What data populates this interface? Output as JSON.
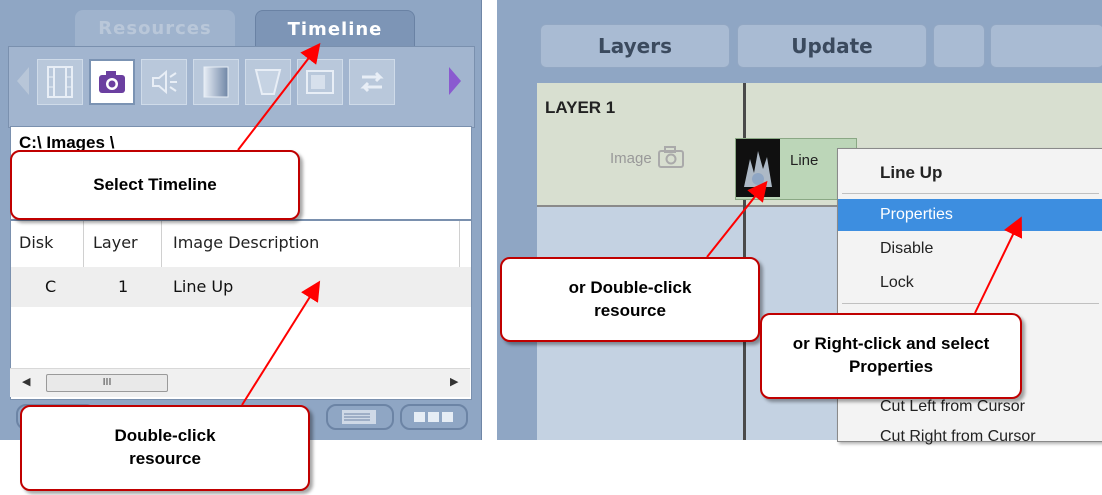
{
  "left_panel": {
    "tabs": [
      {
        "label": "Resources",
        "active": false
      },
      {
        "label": "Timeline",
        "active": true
      }
    ],
    "toolbar": {
      "icons": [
        "prev-arrow-icon",
        "film-icon",
        "camera-icon",
        "audio-icon",
        "gradient-icon",
        "shape-icon",
        "screen-icon",
        "swap-icon",
        "next-arrow-icon"
      ],
      "active_icon": "camera-icon"
    },
    "path": "C:\\ Images \\",
    "table": {
      "columns": [
        "Disk",
        "Layer",
        "Image Description"
      ],
      "rows": [
        {
          "disk": "C",
          "layer": "1",
          "description": "Line Up"
        }
      ]
    },
    "scrollbar_thumb_text": "III"
  },
  "right_panel": {
    "buttons": {
      "layers": "Layers",
      "update": "Update"
    },
    "layer_title": "LAYER 1",
    "image_label": "Image",
    "clip_label": "Line",
    "context_menu": {
      "header": "Line Up",
      "items": [
        "Properties",
        "Disable",
        "Lock",
        "Cut Left from Cursor",
        "Cut Right from Cursor"
      ],
      "selected": "Properties"
    }
  },
  "callouts": {
    "select_timeline": "Select Timeline",
    "double_click_left": "Double-click resource",
    "double_click_right": "or Double-click resource",
    "right_click": "or Right-click and select Properties"
  },
  "colors": {
    "panel_bg": "#8fa6c4",
    "callout_border": "#c00000",
    "arrow": "#ff0000",
    "menu_highlight": "#3d8ee0"
  }
}
